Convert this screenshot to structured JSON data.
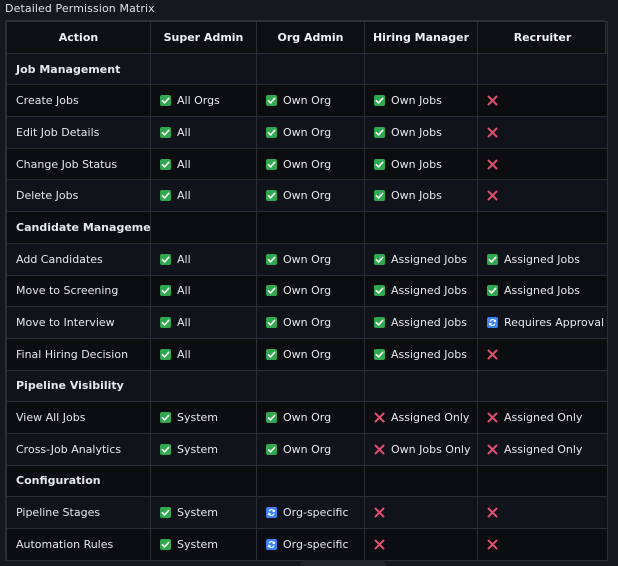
{
  "title": "Detailed Permission Matrix",
  "columns": [
    "Action",
    "Super Admin",
    "Org Admin",
    "Hiring Manager",
    "Recruiter"
  ],
  "icons": {
    "check": {
      "name": "check-icon",
      "color": "#2fa84f"
    },
    "cross": {
      "name": "cross-icon",
      "color": "#e0506e"
    },
    "approval": {
      "name": "approval-icon",
      "color": "#3b82f6"
    }
  },
  "rows": [
    {
      "type": "section",
      "label": "Job Management"
    },
    {
      "type": "row",
      "action": "Create Jobs",
      "cells": [
        {
          "icon": "check",
          "text": "All Orgs"
        },
        {
          "icon": "check",
          "text": "Own Org"
        },
        {
          "icon": "check",
          "text": "Own Jobs"
        },
        {
          "icon": "cross",
          "text": ""
        }
      ]
    },
    {
      "type": "row",
      "action": "Edit Job Details",
      "cells": [
        {
          "icon": "check",
          "text": "All"
        },
        {
          "icon": "check",
          "text": "Own Org"
        },
        {
          "icon": "check",
          "text": "Own Jobs"
        },
        {
          "icon": "cross",
          "text": ""
        }
      ]
    },
    {
      "type": "row",
      "action": "Change Job Status",
      "cells": [
        {
          "icon": "check",
          "text": "All"
        },
        {
          "icon": "check",
          "text": "Own Org"
        },
        {
          "icon": "check",
          "text": "Own Jobs"
        },
        {
          "icon": "cross",
          "text": ""
        }
      ]
    },
    {
      "type": "row",
      "action": "Delete Jobs",
      "cells": [
        {
          "icon": "check",
          "text": "All"
        },
        {
          "icon": "check",
          "text": "Own Org"
        },
        {
          "icon": "check",
          "text": "Own Jobs"
        },
        {
          "icon": "cross",
          "text": ""
        }
      ]
    },
    {
      "type": "section",
      "label": "Candidate Management"
    },
    {
      "type": "row",
      "action": "Add Candidates",
      "cells": [
        {
          "icon": "check",
          "text": "All"
        },
        {
          "icon": "check",
          "text": "Own Org"
        },
        {
          "icon": "check",
          "text": "Assigned Jobs"
        },
        {
          "icon": "check",
          "text": "Assigned Jobs"
        }
      ]
    },
    {
      "type": "row",
      "action": "Move to Screening",
      "cells": [
        {
          "icon": "check",
          "text": "All"
        },
        {
          "icon": "check",
          "text": "Own Org"
        },
        {
          "icon": "check",
          "text": "Assigned Jobs"
        },
        {
          "icon": "check",
          "text": "Assigned Jobs"
        }
      ]
    },
    {
      "type": "row",
      "action": "Move to Interview",
      "cells": [
        {
          "icon": "check",
          "text": "All"
        },
        {
          "icon": "check",
          "text": "Own Org"
        },
        {
          "icon": "check",
          "text": "Assigned Jobs"
        },
        {
          "icon": "approval",
          "text": "Requires Approval"
        }
      ]
    },
    {
      "type": "row",
      "action": "Final Hiring Decision",
      "cells": [
        {
          "icon": "check",
          "text": "All"
        },
        {
          "icon": "check",
          "text": "Own Org"
        },
        {
          "icon": "check",
          "text": "Assigned Jobs"
        },
        {
          "icon": "cross",
          "text": ""
        }
      ]
    },
    {
      "type": "section",
      "label": "Pipeline Visibility"
    },
    {
      "type": "row",
      "action": "View All Jobs",
      "cells": [
        {
          "icon": "check",
          "text": "System"
        },
        {
          "icon": "check",
          "text": "Own Org"
        },
        {
          "icon": "cross",
          "text": "Assigned Only"
        },
        {
          "icon": "cross",
          "text": "Assigned Only"
        }
      ]
    },
    {
      "type": "row",
      "action": "Cross-Job Analytics",
      "cells": [
        {
          "icon": "check",
          "text": "System"
        },
        {
          "icon": "check",
          "text": "Own Org"
        },
        {
          "icon": "cross",
          "text": "Own Jobs Only"
        },
        {
          "icon": "cross",
          "text": "Assigned Only"
        }
      ]
    },
    {
      "type": "section",
      "label": "Configuration"
    },
    {
      "type": "row",
      "action": "Pipeline Stages",
      "cells": [
        {
          "icon": "check",
          "text": "System"
        },
        {
          "icon": "approval",
          "text": "Org-specific"
        },
        {
          "icon": "cross",
          "text": ""
        },
        {
          "icon": "cross",
          "text": ""
        }
      ]
    },
    {
      "type": "row",
      "action": "Automation Rules",
      "cells": [
        {
          "icon": "check",
          "text": "System"
        },
        {
          "icon": "approval",
          "text": "Org-specific"
        },
        {
          "icon": "cross",
          "text": ""
        },
        {
          "icon": "cross",
          "text": ""
        }
      ]
    }
  ]
}
